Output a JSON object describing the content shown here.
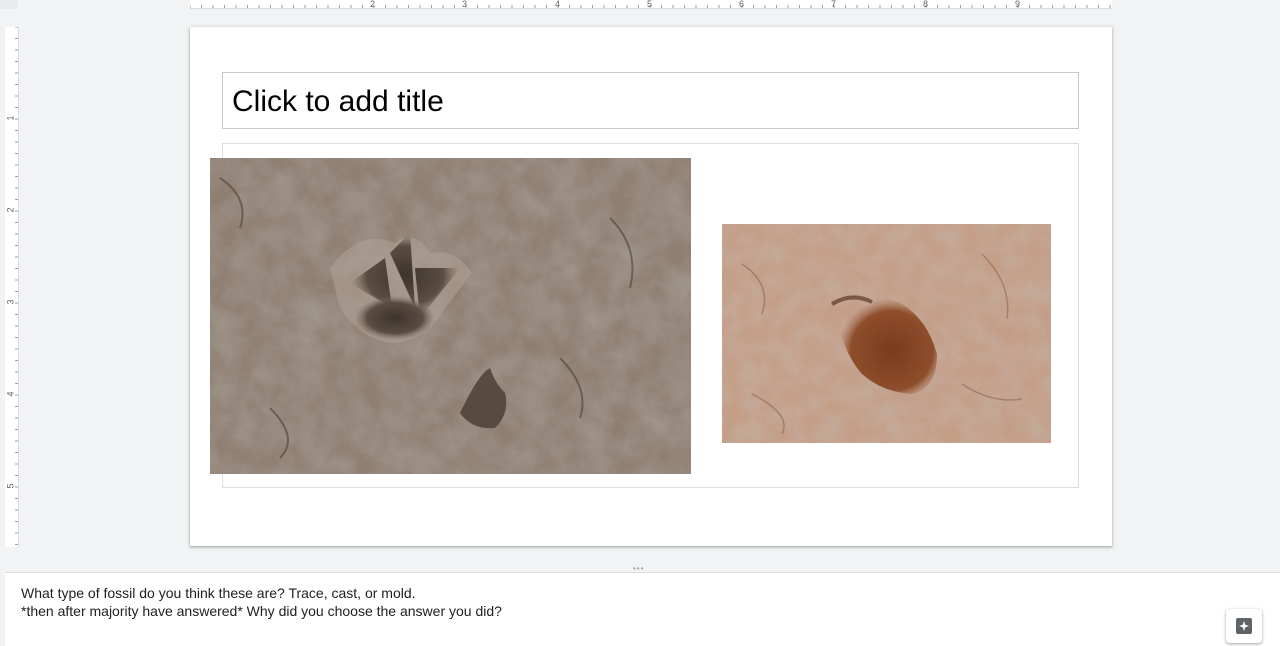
{
  "ruler": {
    "horizontal_numbers": [
      "2",
      "3",
      "4",
      "5",
      "6",
      "7",
      "8",
      "9"
    ],
    "vertical_numbers": [
      "1",
      "2",
      "3",
      "4",
      "5"
    ]
  },
  "slide": {
    "title_placeholder": "Click to add title",
    "images": [
      {
        "name": "dinosaur-footprint-photo-1",
        "icon": "footprint-image"
      },
      {
        "name": "dinosaur-footprint-photo-2",
        "icon": "footprint-image"
      }
    ]
  },
  "notes": {
    "line1": "What type of fossil do you think these are? Trace, cast, or mold.",
    "line2": "*then after majority have answered* Why did you choose the answer you did?"
  },
  "explore": {
    "icon": "explore-sparkle-icon"
  },
  "colors": {
    "background": "#f1f3f4",
    "slide": "#ffffff",
    "rock1": "#8a7a6c",
    "rock2": "#b08a74",
    "print2": "#7a3b1c"
  }
}
